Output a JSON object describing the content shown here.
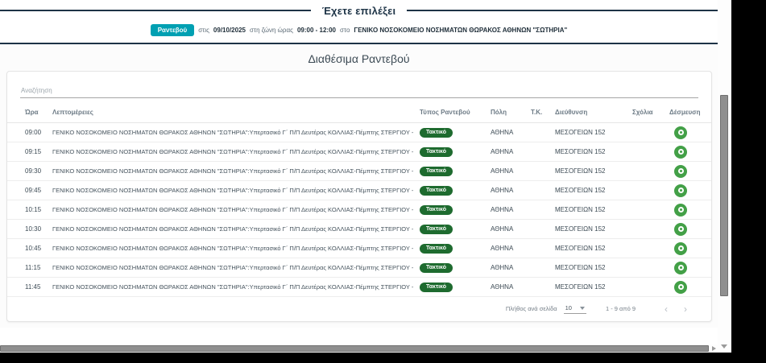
{
  "header": {
    "title": "Έχετε επιλέξει",
    "selection": {
      "badge": "Ραντεβού",
      "pre_date": "στις",
      "date": "09/10/2025",
      "pre_time": "στη ζώνη ώρας",
      "time_range": "09:00 - 12:00",
      "pre_location": "στο",
      "location": "ΓΕΝΙΚΟ ΝΟΣΟΚΟΜΕΙΟ ΝΟΣΗΜΑΤΩΝ ΘΩΡΑΚΟΣ ΑΘΗΝΩΝ \"ΣΩΤΗΡΙΑ\""
    }
  },
  "main": {
    "heading": "Διαθέσιμα Ραντεβού",
    "search_placeholder": "Αναζήτηση"
  },
  "table": {
    "columns": [
      "Ώρα",
      "Λεπτομέρειες",
      "Τύπος Ραντεβού",
      "Πόλη",
      "Τ.Κ.",
      "Διεύθυνση",
      "Σχόλια",
      "Δέσμευση"
    ],
    "rows": [
      {
        "time": "09:00",
        "details": "ΓΕΝΙΚΟ ΝΟΣΟΚΟΜΕΙΟ ΝΟΣΗΜΑΤΩΝ ΘΩΡΑΚΟΣ ΑΘΗΝΩΝ \"ΣΩΤΗΡΙΑ\":Υπερτασικό Γ΄ Π/Π Δευτέρας ΚΟΛΛΙΑΣ-Πέμπτης ΣΤΕΡΓΙΟΥ -",
        "type": "Τακτικό",
        "city": "ΑΘΗΝΑ",
        "tk": "",
        "address": "ΜΕΣΟΓΕΙΩΝ 152",
        "comments": ""
      },
      {
        "time": "09:15",
        "details": "ΓΕΝΙΚΟ ΝΟΣΟΚΟΜΕΙΟ ΝΟΣΗΜΑΤΩΝ ΘΩΡΑΚΟΣ ΑΘΗΝΩΝ \"ΣΩΤΗΡΙΑ\":Υπερτασικό Γ΄ Π/Π Δευτέρας ΚΟΛΛΙΑΣ-Πέμπτης ΣΤΕΡΓΙΟΥ -",
        "type": "Τακτικό",
        "city": "ΑΘΗΝΑ",
        "tk": "",
        "address": "ΜΕΣΟΓΕΙΩΝ 152",
        "comments": ""
      },
      {
        "time": "09:30",
        "details": "ΓΕΝΙΚΟ ΝΟΣΟΚΟΜΕΙΟ ΝΟΣΗΜΑΤΩΝ ΘΩΡΑΚΟΣ ΑΘΗΝΩΝ \"ΣΩΤΗΡΙΑ\":Υπερτασικό Γ΄ Π/Π Δευτέρας ΚΟΛΛΙΑΣ-Πέμπτης ΣΤΕΡΓΙΟΥ -",
        "type": "Τακτικό",
        "city": "ΑΘΗΝΑ",
        "tk": "",
        "address": "ΜΕΣΟΓΕΙΩΝ 152",
        "comments": ""
      },
      {
        "time": "09:45",
        "details": "ΓΕΝΙΚΟ ΝΟΣΟΚΟΜΕΙΟ ΝΟΣΗΜΑΤΩΝ ΘΩΡΑΚΟΣ ΑΘΗΝΩΝ \"ΣΩΤΗΡΙΑ\":Υπερτασικό Γ΄ Π/Π Δευτέρας ΚΟΛΛΙΑΣ-Πέμπτης ΣΤΕΡΓΙΟΥ -",
        "type": "Τακτικό",
        "city": "ΑΘΗΝΑ",
        "tk": "",
        "address": "ΜΕΣΟΓΕΙΩΝ 152",
        "comments": ""
      },
      {
        "time": "10:15",
        "details": "ΓΕΝΙΚΟ ΝΟΣΟΚΟΜΕΙΟ ΝΟΣΗΜΑΤΩΝ ΘΩΡΑΚΟΣ ΑΘΗΝΩΝ \"ΣΩΤΗΡΙΑ\":Υπερτασικό Γ΄ Π/Π Δευτέρας ΚΟΛΛΙΑΣ-Πέμπτης ΣΤΕΡΓΙΟΥ -",
        "type": "Τακτικό",
        "city": "ΑΘΗΝΑ",
        "tk": "",
        "address": "ΜΕΣΟΓΕΙΩΝ 152",
        "comments": ""
      },
      {
        "time": "10:30",
        "details": "ΓΕΝΙΚΟ ΝΟΣΟΚΟΜΕΙΟ ΝΟΣΗΜΑΤΩΝ ΘΩΡΑΚΟΣ ΑΘΗΝΩΝ \"ΣΩΤΗΡΙΑ\":Υπερτασικό Γ΄ Π/Π Δευτέρας ΚΟΛΛΙΑΣ-Πέμπτης ΣΤΕΡΓΙΟΥ -",
        "type": "Τακτικό",
        "city": "ΑΘΗΝΑ",
        "tk": "",
        "address": "ΜΕΣΟΓΕΙΩΝ 152",
        "comments": ""
      },
      {
        "time": "10:45",
        "details": "ΓΕΝΙΚΟ ΝΟΣΟΚΟΜΕΙΟ ΝΟΣΗΜΑΤΩΝ ΘΩΡΑΚΟΣ ΑΘΗΝΩΝ \"ΣΩΤΗΡΙΑ\":Υπερτασικό Γ΄ Π/Π Δευτέρας ΚΟΛΛΙΑΣ-Πέμπτης ΣΤΕΡΓΙΟΥ -",
        "type": "Τακτικό",
        "city": "ΑΘΗΝΑ",
        "tk": "",
        "address": "ΜΕΣΟΓΕΙΩΝ 152",
        "comments": ""
      },
      {
        "time": "11:15",
        "details": "ΓΕΝΙΚΟ ΝΟΣΟΚΟΜΕΙΟ ΝΟΣΗΜΑΤΩΝ ΘΩΡΑΚΟΣ ΑΘΗΝΩΝ \"ΣΩΤΗΡΙΑ\":Υπερτασικό Γ΄ Π/Π Δευτέρας ΚΟΛΛΙΑΣ-Πέμπτης ΣΤΕΡΓΙΟΥ -",
        "type": "Τακτικό",
        "city": "ΑΘΗΝΑ",
        "tk": "",
        "address": "ΜΕΣΟΓΕΙΩΝ 152",
        "comments": ""
      },
      {
        "time": "11:45",
        "details": "ΓΕΝΙΚΟ ΝΟΣΟΚΟΜΕΙΟ ΝΟΣΗΜΑΤΩΝ ΘΩΡΑΚΟΣ ΑΘΗΝΩΝ \"ΣΩΤΗΡΙΑ\":Υπερτασικό Γ΄ Π/Π Δευτέρας ΚΟΛΛΙΑΣ-Πέμπτης ΣΤΕΡΓΙΟΥ -",
        "type": "Τακτικό",
        "city": "ΑΘΗΝΑ",
        "tk": "",
        "address": "ΜΕΣΟΓΕΙΩΝ 152",
        "comments": ""
      }
    ]
  },
  "paginator": {
    "per_page_label": "Πλήθος ανά σελίδα",
    "per_page_value": "10",
    "range_label": "1 - 9 από 9",
    "prev_icon": "‹",
    "next_icon": "›"
  },
  "colors": {
    "accent_teal": "#00a0b2",
    "type_badge_green": "#1e6b2f",
    "action_green": "#43a047",
    "header_navy": "#1d3346"
  }
}
